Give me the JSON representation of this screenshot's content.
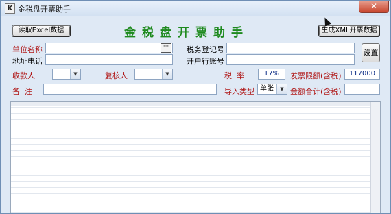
{
  "window": {
    "title": "金税盘开票助手",
    "app_icon_letter": "K",
    "close_symbol": "✕"
  },
  "toolbar": {
    "read_excel_label": "读取Excel数据",
    "generate_xml_label": "生成XML开票数据"
  },
  "app_title": "金税盘开票助手",
  "form": {
    "unit_name_label": "单位名称",
    "unit_name_value": "",
    "browse_label": "···",
    "address_phone_label": "地址电话",
    "address_phone_value": "",
    "tax_reg_label": "税务登记号",
    "tax_reg_value": "",
    "bank_account_label": "开户行账号",
    "bank_account_value": "",
    "settings_label": "设置",
    "payee_label": "收款人",
    "payee_value": "",
    "reviewer_label": "复核人",
    "reviewer_value": "",
    "tax_rate_label": "税  率",
    "tax_rate_value": "17%",
    "invoice_limit_label": "发票限额(含税)",
    "invoice_limit_value": "117000",
    "remark_label": "备  注",
    "remark_value": "",
    "import_type_label": "导入类型",
    "import_type_value": "单张",
    "amount_total_label": "金额合计(含税)",
    "amount_total_value": ""
  },
  "colors": {
    "title_green": "#1e8a1e",
    "label_red": "#b01818",
    "value_blue": "#0b2c85"
  }
}
